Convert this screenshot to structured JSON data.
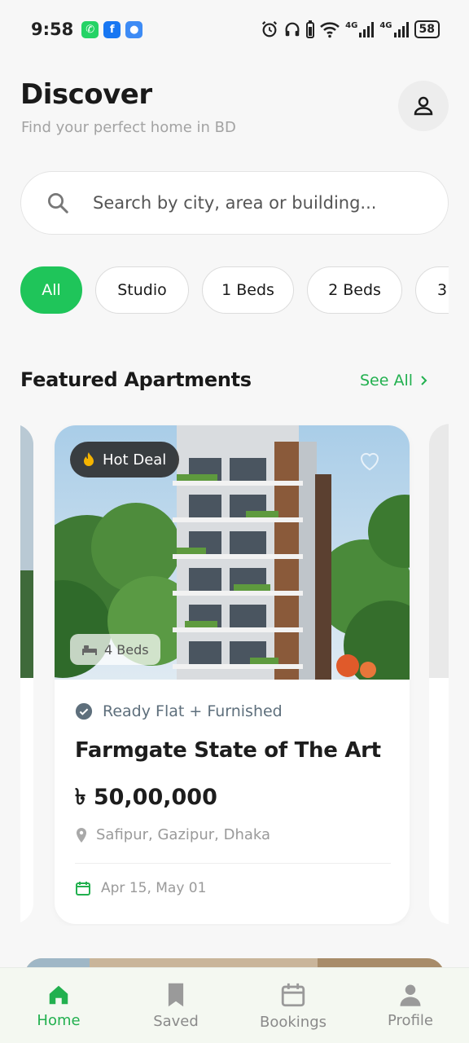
{
  "status_bar": {
    "time": "9:58",
    "signal_label_1": "4G",
    "signal_label_2": "4G",
    "battery": "58"
  },
  "header": {
    "title": "Discover",
    "subtitle": "Find your perfect home in BD"
  },
  "search": {
    "placeholder": "Search by city, area or building..."
  },
  "filters": {
    "chips": [
      "All",
      "Studio",
      "1 Beds",
      "2 Beds",
      "3"
    ],
    "selected": "All"
  },
  "featured": {
    "section_title": "Featured Apartments",
    "see_all_label": "See All",
    "card": {
      "badge_label": "Hot Deal",
      "beds_label": "4 Beds",
      "status": "Ready Flat + Furnished",
      "title": "Farmgate State of The Art",
      "price": "৳ 50,00,000",
      "location": "Safipur, Gazipur, Dhaka",
      "dates": "Apr 15, May 01"
    }
  },
  "bottom_nav": {
    "items": [
      {
        "label": "Home",
        "icon": "home-icon",
        "active": true
      },
      {
        "label": "Saved",
        "icon": "bookmark-icon",
        "active": false
      },
      {
        "label": "Bookings",
        "icon": "calendar-icon",
        "active": false
      },
      {
        "label": "Profile",
        "icon": "user-icon",
        "active": false
      }
    ]
  },
  "colors": {
    "accent": "#1fc55a",
    "accent_text": "#22b04f",
    "background": "#f7f7f7"
  }
}
